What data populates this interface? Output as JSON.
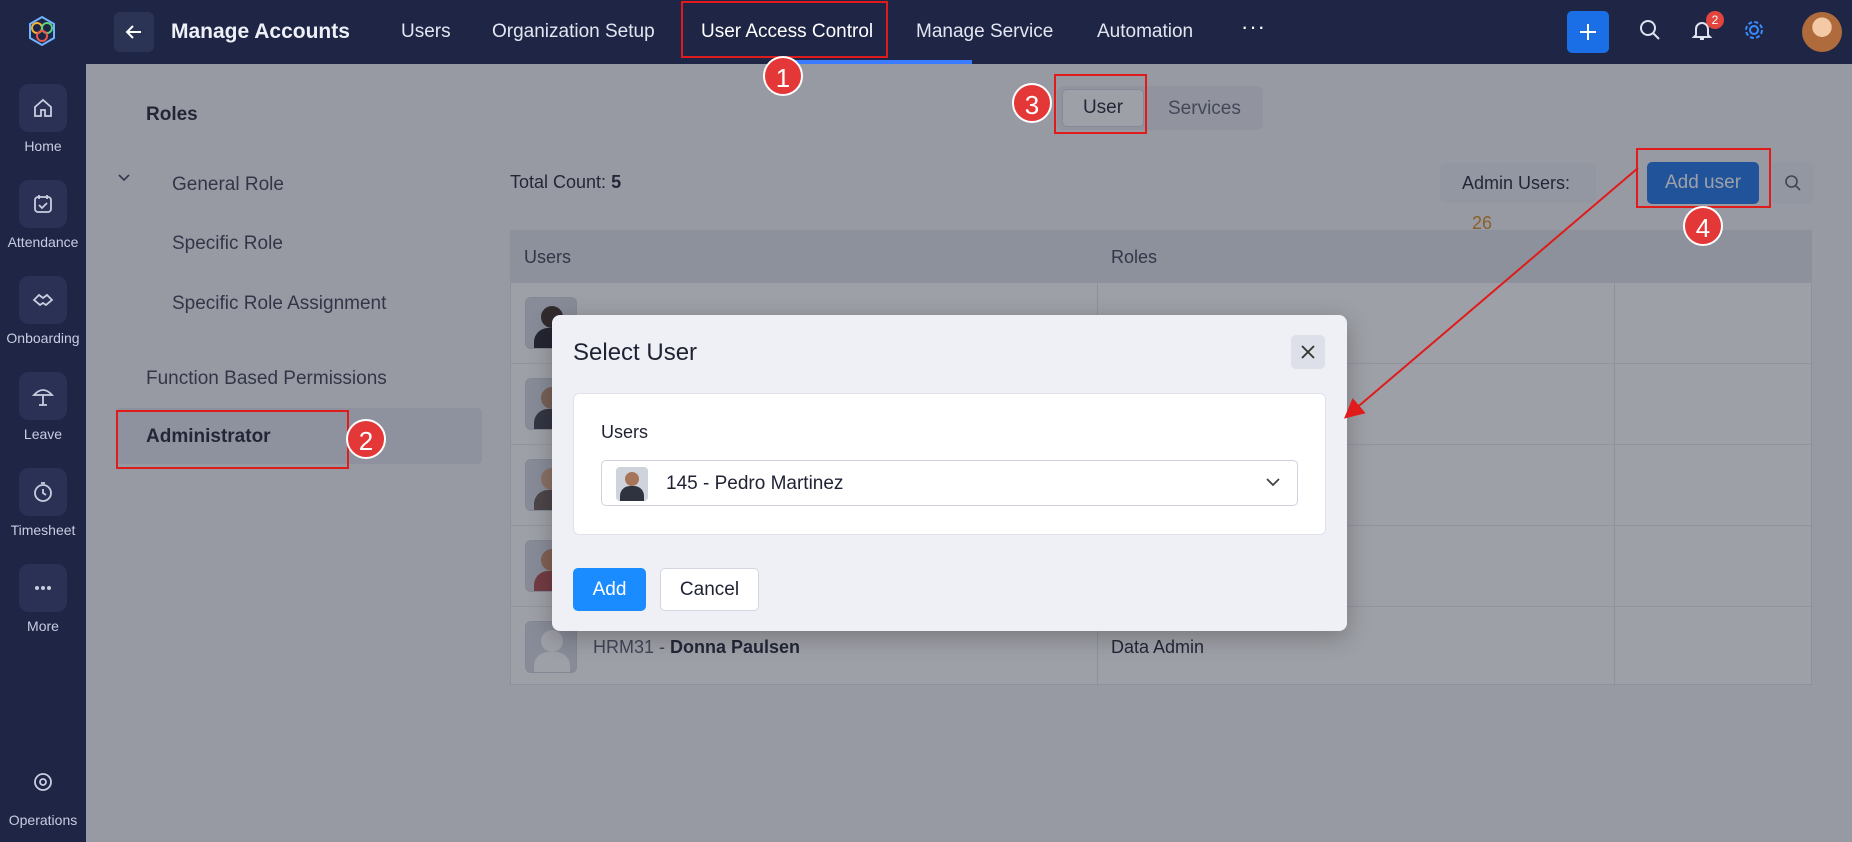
{
  "rail": {
    "items": [
      {
        "label": "Home",
        "icon": "home-icon"
      },
      {
        "label": "Attendance",
        "icon": "attendance-icon"
      },
      {
        "label": "Onboarding",
        "icon": "onboarding-icon"
      },
      {
        "label": "Leave",
        "icon": "leave-icon"
      },
      {
        "label": "Timesheet",
        "icon": "timesheet-icon"
      },
      {
        "label": "More",
        "icon": "more-icon"
      }
    ],
    "bottom": {
      "label": "Operations",
      "icon": "operations-icon"
    }
  },
  "topbar": {
    "title": "Manage Accounts",
    "tabs": [
      "Users",
      "Organization Setup",
      "User Access Control",
      "Manage Service",
      "Automation"
    ],
    "active_tab": "User Access Control",
    "more": "···",
    "notifications_count": "2"
  },
  "leftpanel": {
    "section": "Roles",
    "subitems": [
      "General Role",
      "Specific Role",
      "Specific Role Assignment"
    ],
    "items": [
      "Function Based Permissions",
      "Administrator"
    ],
    "selected": "Administrator"
  },
  "main": {
    "segment": {
      "user": "User",
      "services": "Services"
    },
    "total_count_label": "Total Count:",
    "total_count_value": "5",
    "admin_users_label": "Admin Users:",
    "admin_users_value": "26",
    "add_user": "Add user",
    "table": {
      "headers": [
        "Users",
        "Roles"
      ],
      "rows": [
        {
          "id": "",
          "name": "",
          "role": ""
        },
        {
          "id": "",
          "name": "",
          "role": ""
        },
        {
          "id": "",
          "name": "",
          "role": ""
        },
        {
          "id": "",
          "name": "",
          "role": ""
        },
        {
          "id": "HRM31 -",
          "name": "Donna Paulsen",
          "role": "Data Admin"
        }
      ]
    }
  },
  "modal": {
    "title": "Select User",
    "field_label": "Users",
    "selected_user": "145 - Pedro Martinez",
    "add": "Add",
    "cancel": "Cancel"
  },
  "annotations": [
    "1",
    "2",
    "3",
    "4"
  ],
  "colors": {
    "accent": "#1a73e8",
    "rail": "#1e2545",
    "annotation": "#e01b1b"
  }
}
